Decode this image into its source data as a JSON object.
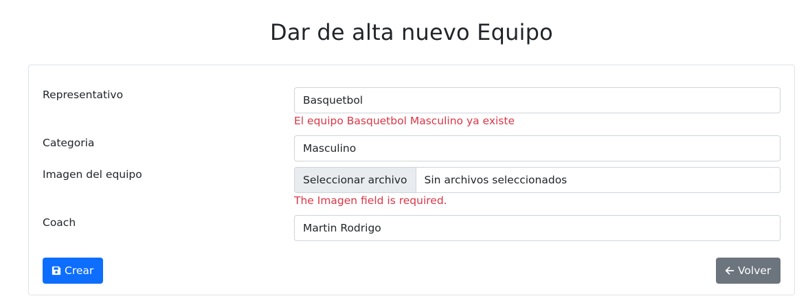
{
  "page": {
    "title": "Dar de alta nuevo Equipo"
  },
  "form": {
    "representativo": {
      "label": "Representativo",
      "value": "Basquetbol",
      "error": "El equipo Basquetbol Masculino ya existe"
    },
    "categoria": {
      "label": "Categoria",
      "value": "Masculino"
    },
    "imagen": {
      "label": "Imagen del equipo",
      "button_label": "Seleccionar archivo",
      "status": "Sin archivos seleccionados",
      "error": "The Imagen field is required."
    },
    "coach": {
      "label": "Coach",
      "value": "Martin Rodrigo"
    }
  },
  "actions": {
    "create_label": "Crear",
    "create_icon": "save-icon",
    "back_label": "Volver",
    "back_icon": "arrow-left-icon"
  },
  "colors": {
    "primary": "#0d6efd",
    "secondary": "#6c757d",
    "danger": "#dc3545"
  }
}
